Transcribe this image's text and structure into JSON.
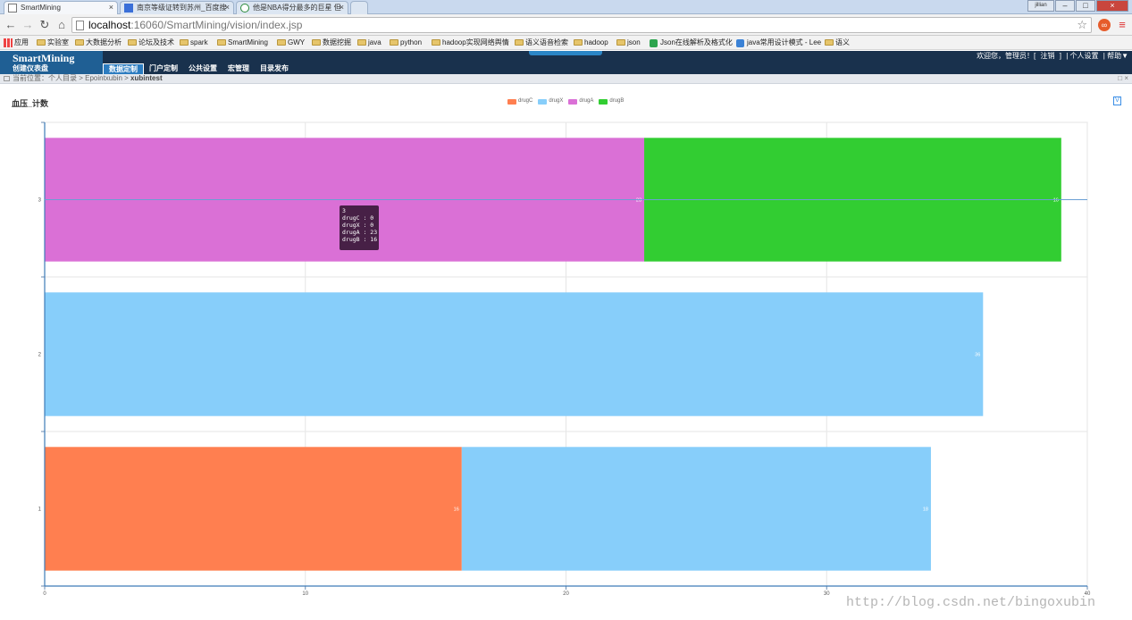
{
  "browser": {
    "tabs": [
      {
        "label": "SmartMining",
        "close": "×"
      },
      {
        "label": "南京等级证转到苏州_百度搜",
        "close": "×"
      },
      {
        "label": "他是NBA得分最多的巨星 但",
        "close": "×"
      }
    ],
    "window_controls": {
      "user": "jillian",
      "minimize": "–",
      "maximize": "□",
      "close": "×"
    },
    "address": {
      "host": "localhost",
      "rest": ":16060/SmartMining/vision/index.jsp"
    },
    "bookmarks": [
      "应用",
      "实验室",
      "大数据分析",
      "论坛及技术",
      "spark",
      "SmartMining",
      "GWY",
      "数据挖掘",
      "java",
      "python",
      "hadoop实现网络舆情",
      "语义语音检索",
      "hadoop",
      "json",
      "Json在线解析及格式化",
      "java常用设计模式 - Lee",
      "语义"
    ]
  },
  "app": {
    "logo_title": "SmartMining",
    "logo_subtitle": "创建仪表盘",
    "menu": [
      "数据定制",
      "门户定制",
      "公共设置",
      "宏管理",
      "目录发布"
    ],
    "user_bar": {
      "welcome": "欢迎您，管理员！[",
      "logout": "注销",
      "bracket_close": "]",
      "personal": "| 个人设置",
      "help": "| 帮助▼"
    },
    "breadcrumb": {
      "prefix": "当前位置：",
      "path": "个人目录 > Epointxubin > ",
      "current": "xubintest",
      "controls": "□ ×"
    }
  },
  "chart_title": "血压_计数",
  "toolbox_label": "V",
  "chart_data": {
    "type": "bar",
    "orientation": "horizontal",
    "stacked": true,
    "categories": [
      "1",
      "2",
      "3"
    ],
    "series": [
      {
        "name": "drugC",
        "color": "#ff7f50",
        "values": [
          16,
          0,
          0
        ]
      },
      {
        "name": "drugX",
        "color": "#87cefa",
        "values": [
          18,
          36,
          0
        ]
      },
      {
        "name": "drugA",
        "color": "#da70d6",
        "values": [
          0,
          0,
          23
        ]
      },
      {
        "name": "drugB",
        "color": "#32cd32",
        "values": [
          0,
          0,
          16
        ]
      }
    ],
    "xlim": [
      0,
      40
    ],
    "x_ticks": [
      "0",
      "10",
      "20",
      "30",
      "40"
    ],
    "legend_position": "top-center",
    "grid": true
  },
  "tooltip": {
    "category": "3",
    "lines": [
      "drugC : 0",
      "drugX : 0",
      "drugA : 23",
      "drugB : 16"
    ]
  },
  "watermark": "http://blog.csdn.net/bingoxubin"
}
